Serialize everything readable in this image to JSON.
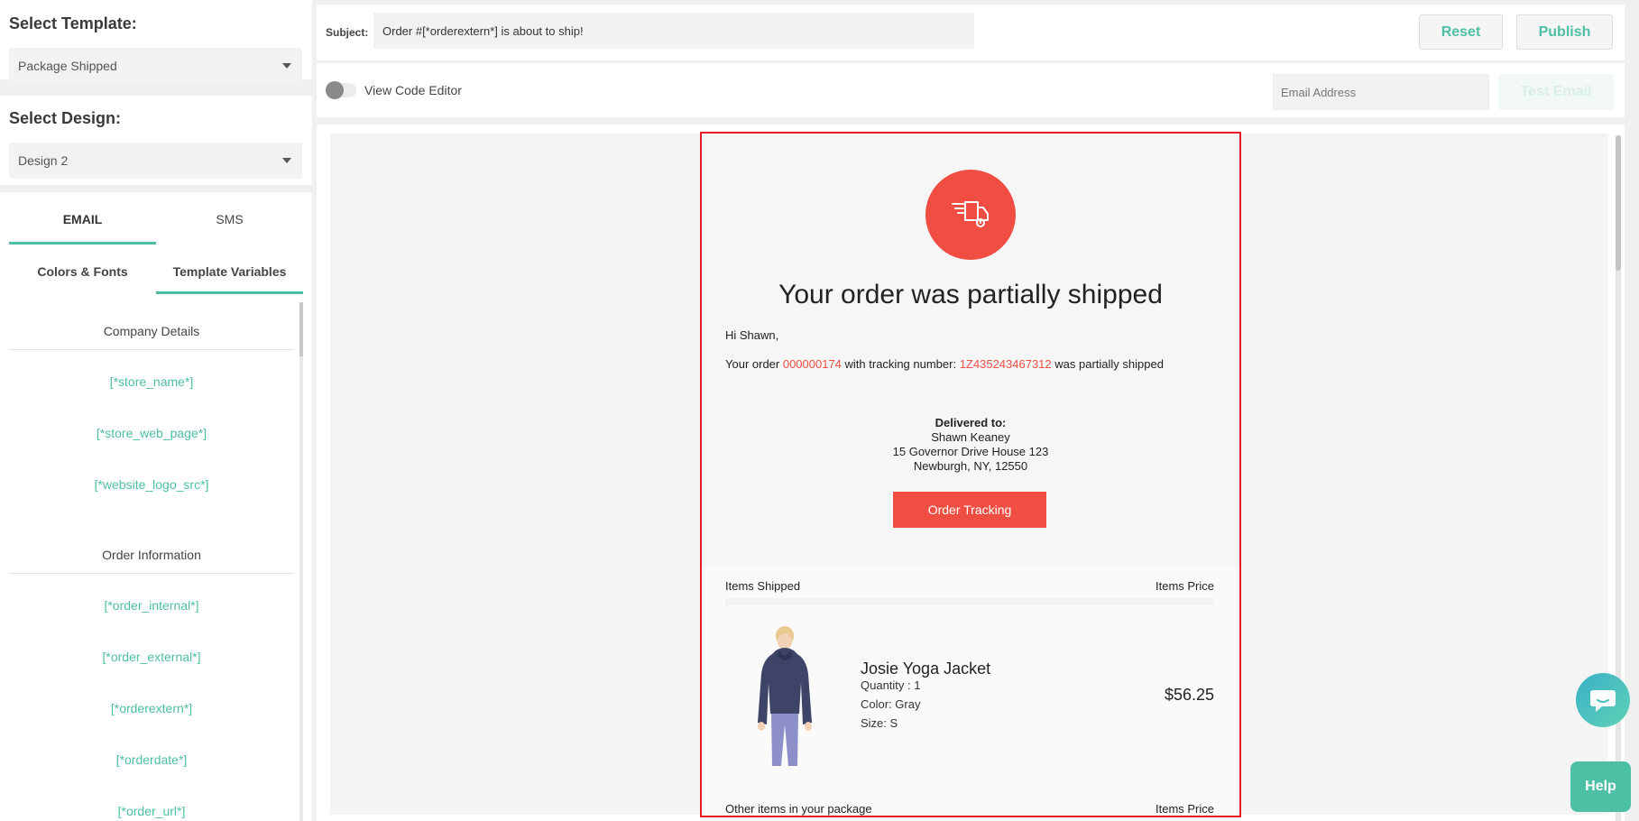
{
  "sidebar": {
    "template_title": "Select Template:",
    "template_value": "Package Shipped",
    "design_title": "Select Design:",
    "design_value": "Design 2",
    "channel_tabs": [
      "EMAIL",
      "SMS"
    ],
    "sub_tabs": [
      "Colors & Fonts",
      "Template Variables"
    ],
    "groups": [
      {
        "heading": "Company Details",
        "vars": [
          "[*store_name*]",
          "[*store_web_page*]",
          "[*website_logo_src*]"
        ]
      },
      {
        "heading": "Order Information",
        "vars": [
          "[*order_internal*]",
          "[*order_external*]",
          "[*orderextern*]",
          "[*orderdate*]",
          "[*order_url*]"
        ]
      }
    ]
  },
  "toolbar": {
    "subject_label": "Subject:",
    "subject_value": "Order #[*orderextern*] is about to ship!",
    "reset_label": "Reset",
    "publish_label": "Publish",
    "toggle_label": "View Code Editor",
    "email_placeholder": "Email Address",
    "test_label": "Test Email"
  },
  "email": {
    "heading": "Your order was partially shipped",
    "greeting": "Hi Shawn,",
    "order_prefix": "Your order ",
    "order_number": "000000174",
    "tracking_prefix": " with tracking number: ",
    "tracking_number": "1Z435243467312",
    "order_suffix": " was partially shipped",
    "delivered_label": "Delivered to:",
    "delivered_name": "Shawn Keaney",
    "delivered_street": "15 Governor Drive House 123",
    "delivered_city": "Newburgh, NY, 12550",
    "tracking_button": "Order Tracking",
    "items_shipped": "Items Shipped",
    "items_price": "Items Price",
    "product": {
      "name": "Josie Yoga Jacket",
      "quantity": "Quantity : 1",
      "color": "Color: Gray",
      "size": "Size: S",
      "price": "$56.25"
    },
    "other_items": "Other items in your package",
    "other_price": "Items Price"
  },
  "floating": {
    "help_label": "Help"
  },
  "colors": {
    "accent": "#4dbfa4",
    "email_red": "#f04e43",
    "highlight_border": "#e41e26"
  }
}
